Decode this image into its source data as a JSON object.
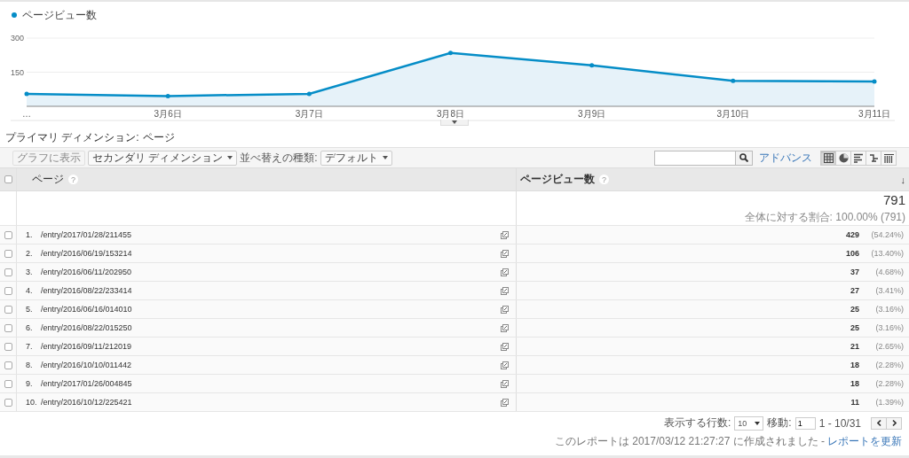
{
  "chart": {
    "chart_data": {
      "type": "area",
      "categories": [
        "…",
        "3月6日",
        "3月7日",
        "3月8日",
        "3月9日",
        "3月10日",
        "3月11日"
      ],
      "series": [
        {
          "name": "ページビュー数",
          "color": "#058dc7",
          "values": [
            55,
            45,
            55,
            235,
            180,
            112,
            109
          ]
        }
      ],
      "ylim": [
        0,
        300
      ],
      "yticks": [
        150,
        300
      ]
    }
  },
  "primary_dimension": {
    "label": "プライマリ ディメンション:",
    "value": "ページ"
  },
  "toolbar": {
    "plot_button": {
      "label": "グラフに表示",
      "disabled": true
    },
    "secondary_dimension": "セカンダリ ディメンション",
    "sort_label": "並べ替えの種類:",
    "sort_value": "デフォルト",
    "advanced": "アドバンス",
    "views": [
      {
        "kind": "table",
        "selected": true
      },
      {
        "kind": "pie",
        "selected": false
      },
      {
        "kind": "bar",
        "selected": false
      },
      {
        "kind": "compare",
        "selected": false
      },
      {
        "kind": "pivot",
        "selected": false
      }
    ]
  },
  "table": {
    "header_checked": false,
    "columns": [
      {
        "label": "ページ",
        "help": "?"
      },
      {
        "label": "ページビュー数",
        "help": "?",
        "sort": "↓"
      }
    ],
    "total": {
      "value": "791",
      "share": "全体に対する割合: 100.00% (791)"
    },
    "rows": [
      {
        "index": "1.",
        "page": "/entry/2017/01/28/211455",
        "value": "429",
        "share": "(54.24%)",
        "checked": false
      },
      {
        "index": "2.",
        "page": "/entry/2016/06/19/153214",
        "value": "106",
        "share": "(13.40%)",
        "checked": false
      },
      {
        "index": "3.",
        "page": "/entry/2016/06/11/202950",
        "value": "37",
        "share": "(4.68%)",
        "checked": false
      },
      {
        "index": "4.",
        "page": "/entry/2016/08/22/233414",
        "value": "27",
        "share": "(3.41%)",
        "checked": false
      },
      {
        "index": "5.",
        "page": "/entry/2016/06/16/014010",
        "value": "25",
        "share": "(3.16%)",
        "checked": false
      },
      {
        "index": "6.",
        "page": "/entry/2016/08/22/015250",
        "value": "25",
        "share": "(3.16%)",
        "checked": false
      },
      {
        "index": "7.",
        "page": "/entry/2016/09/11/212019",
        "value": "21",
        "share": "(2.65%)",
        "checked": false
      },
      {
        "index": "8.",
        "page": "/entry/2016/10/10/011442",
        "value": "18",
        "share": "(2.28%)",
        "checked": false
      },
      {
        "index": "9.",
        "page": "/entry/2017/01/26/004845",
        "value": "18",
        "share": "(2.28%)",
        "checked": false
      },
      {
        "index": "10.",
        "page": "/entry/2016/10/12/225421",
        "value": "11",
        "share": "(1.39%)",
        "checked": false
      }
    ]
  },
  "pagination": {
    "rows_label": "表示する行数:",
    "rows_value": "10",
    "goto_label": "移動:",
    "goto_value": "1",
    "range": "1 - 10/31"
  },
  "report": {
    "text": "このレポートは 2017/03/12 21:27:27 に作成されました -",
    "link": "レポートを更新"
  }
}
